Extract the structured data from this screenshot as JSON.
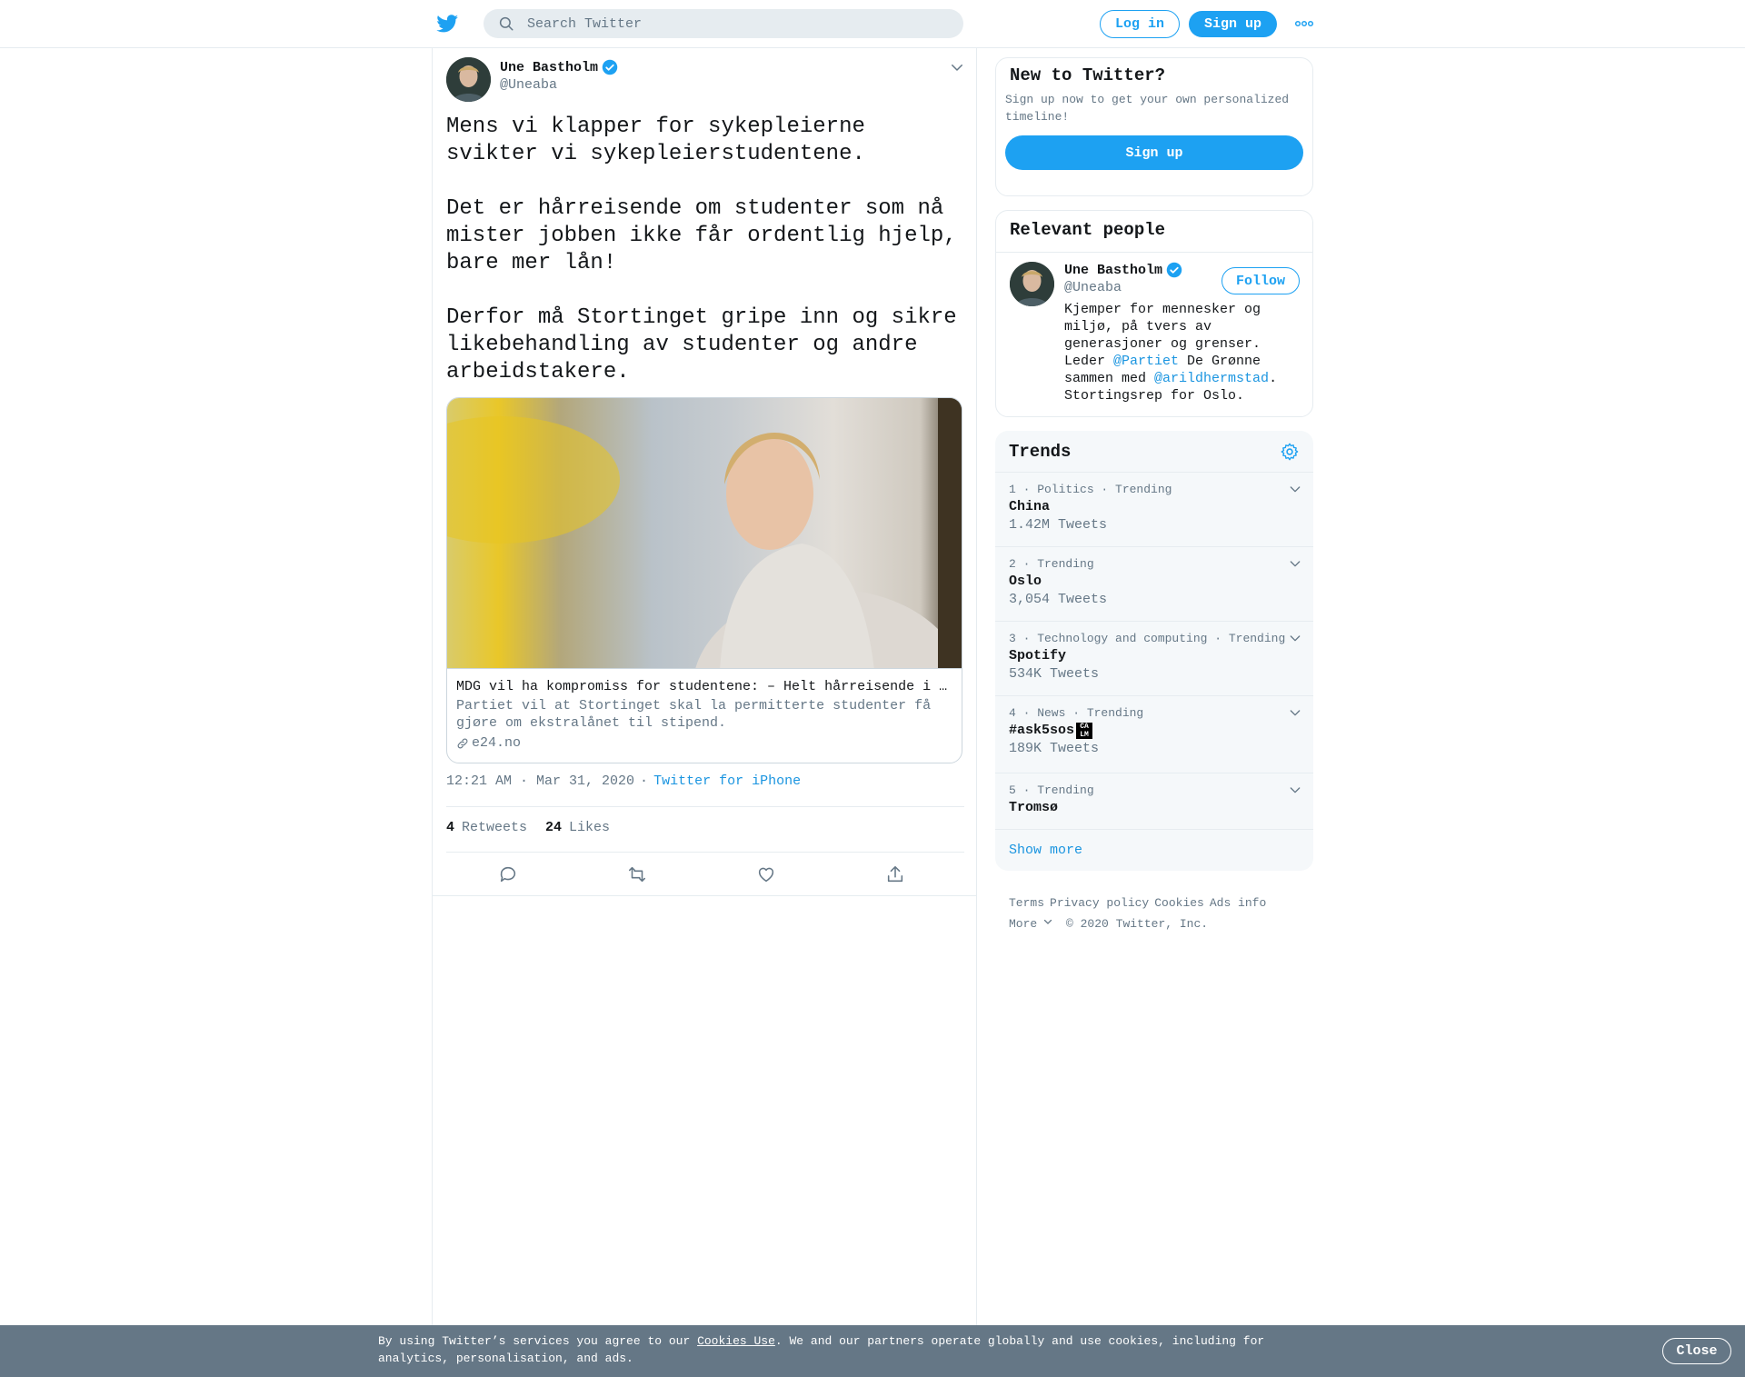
{
  "header": {
    "search_placeholder": "Search Twitter",
    "login_label": "Log in",
    "signup_label": "Sign up"
  },
  "tweet": {
    "author_name": "Une Bastholm",
    "author_handle": "@Uneaba",
    "text": "Mens vi klapper for sykepleierne svikter vi sykepleierstudentene.\n\nDet er hårreisende om studenter som nå mister jobben ikke får ordentlig hjelp, bare mer lån!\n\nDerfor må Stortinget gripe inn og sikre likebehandling av studenter og andre arbeidstakere.",
    "card": {
      "title": "MDG vil ha kompromiss for studentene: – Helt hårreisende i …",
      "description": "Partiet vil at Stortinget skal la permitterte studenter få gjøre om ekstralånet til stipend.",
      "domain": "e24.no"
    },
    "time": "12:21 AM · Mar 31, 2020",
    "separator": "·",
    "source": "Twitter for iPhone",
    "retweets_count": "4",
    "retweets_label": "Retweets",
    "likes_count": "24",
    "likes_label": "Likes"
  },
  "sidebar": {
    "new_title": "New to Twitter?",
    "new_desc": "Sign up now to get your own personalized timeline!",
    "new_signup_label": "Sign up",
    "relevant_title": "Relevant people",
    "person": {
      "name": "Une Bastholm",
      "handle": "@Uneaba",
      "follow_label": "Follow",
      "bio_1": "Kjemper for mennesker og miljø, på tvers av generasjoner og grenser. Leder ",
      "bio_link_1": "@Partiet",
      "bio_2": " De Grønne sammen med ",
      "bio_link_2": "@arildhermstad",
      "bio_3": ". Stortingsrep for Oslo."
    },
    "trends_title": "Trends",
    "trends": [
      {
        "context": "1 · Politics · Trending",
        "name": "China",
        "count": "1.42M Tweets"
      },
      {
        "context": "2 · Trending",
        "name": "Oslo",
        "count": "3,054 Tweets"
      },
      {
        "context": "3 · Technology and computing · Trending",
        "name": "Spotify",
        "count": "534K Tweets"
      },
      {
        "context": "4 · News · Trending",
        "name": "#ask5sos",
        "count": "189K Tweets"
      },
      {
        "context": "5 · Trending",
        "name": "Tromsø",
        "count": ""
      }
    ],
    "show_more": "Show more"
  },
  "footer": {
    "links": [
      "Terms",
      "Privacy policy",
      "Cookies",
      "Ads info"
    ],
    "more": "More",
    "copyright": "© 2020 Twitter, Inc."
  },
  "cookie": {
    "text_1": "By using Twitter’s services you agree to our ",
    "link": "Cookies Use",
    "text_2": ". We and our partners operate globally and use cookies, including for analytics, personalisation, and ads.",
    "close_label": "Close"
  },
  "colors": {
    "accent": "#1da1f2",
    "link": "#1b95e0",
    "muted": "#657786",
    "cookie_bg": "#657786"
  }
}
